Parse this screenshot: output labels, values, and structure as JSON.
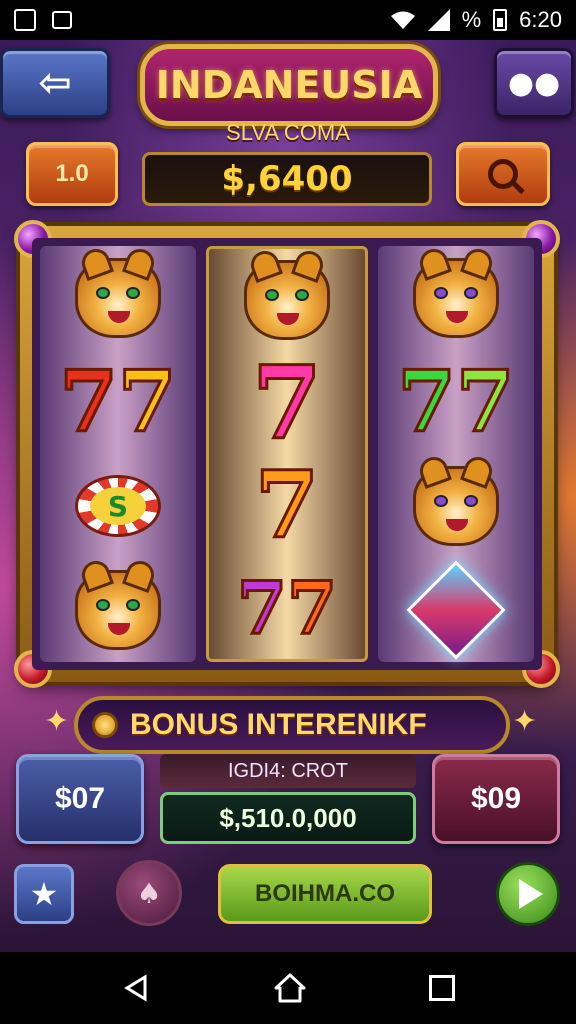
{
  "status_bar": {
    "time": "6:20",
    "left_icons": [
      "notification-icon",
      "screen-icon"
    ],
    "right_icons": [
      "wifi-icon",
      "signal-icon",
      "battery-icon"
    ],
    "percent_symbol": "%"
  },
  "header": {
    "title": "INDANEUSIA",
    "subtitle": "SLVA COMA",
    "back_icon": "arrow-left-icon",
    "menu_icon": "paw-icon"
  },
  "bet": {
    "label": "1.0"
  },
  "balance": {
    "value": "$,6400"
  },
  "reels": [
    [
      "tiger",
      "seven-multi",
      "chip-s",
      "tiger"
    ],
    [
      "tiger",
      "seven-pink",
      "seven-orange",
      "seven-sparkle"
    ],
    [
      "tiger-purple",
      "seven-green",
      "tiger",
      "diamond"
    ]
  ],
  "chip_letter": "S",
  "bonus": {
    "label": "BONUS INTERENIKF"
  },
  "left_box": {
    "value": "$07"
  },
  "right_box": {
    "value": "$09"
  },
  "win": {
    "label": "IGDI4: CROT",
    "value": "$,510.0,000"
  },
  "controls": {
    "spin_label": "BOIHMA.CO",
    "star_icon": "star-icon",
    "settings_icon": "spade-icon",
    "play_icon": "play-icon"
  },
  "nav": {
    "back_icon": "nav-back-icon",
    "home_icon": "nav-home-icon",
    "recent_icon": "nav-recent-icon"
  },
  "colors": {
    "gold": "#ffd86a",
    "frame": "#d9a63a",
    "background": "#3a1a5a"
  }
}
